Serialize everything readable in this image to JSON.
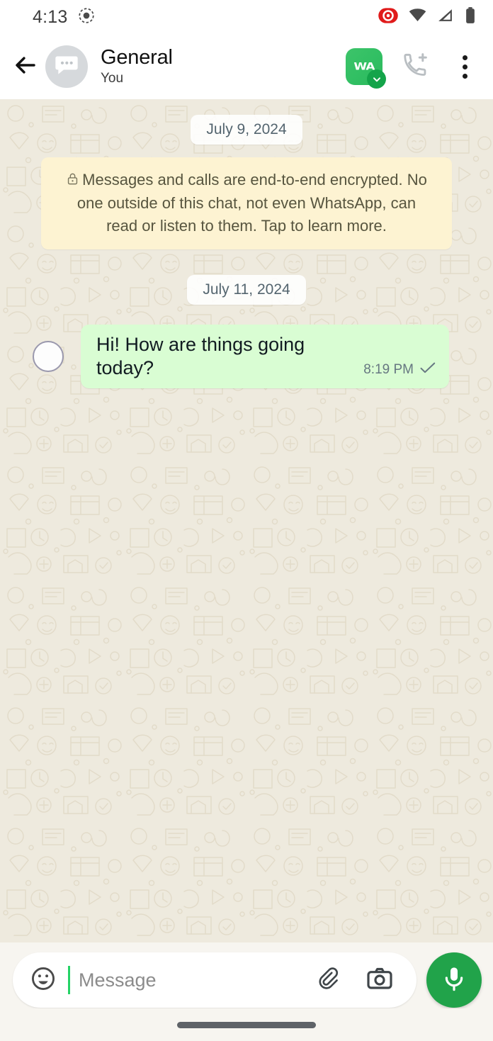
{
  "status_bar": {
    "time": "4:13",
    "left_icons": [
      {
        "name": "screen-record-indicator-icon"
      }
    ],
    "right_icons": [
      {
        "name": "recording-active-icon",
        "color": "#e01b1b"
      },
      {
        "name": "wifi-icon",
        "color": "#4a4a4a"
      },
      {
        "name": "cellular-signal-icon",
        "color": "#4a4a4a"
      },
      {
        "name": "battery-full-icon",
        "color": "#4a4a4a"
      }
    ]
  },
  "app_bar": {
    "back_label": "Back",
    "avatar_icon": "group-chat-bubble-icon",
    "title": "General",
    "subtitle": "You",
    "app_shortcut": {
      "label": "WA",
      "badge_icon": "download-chevron-icon",
      "color": "#31bf63"
    },
    "add_call_label": "Add call",
    "menu_label": "More options"
  },
  "chat": {
    "date_separator_1": "July 9, 2024",
    "encryption_notice": "Messages and calls are end-to-end encrypted. No one outside of this chat, not even WhatsApp, can read or listen to them. Tap to learn more.",
    "date_separator_2": "July 11, 2024",
    "messages": [
      {
        "text": "Hi! How are things going today?",
        "time": "8:19 PM",
        "status_icon": "single-check-icon",
        "outgoing": true,
        "selected": false
      }
    ]
  },
  "composer": {
    "emoji_label": "Emoji",
    "placeholder": "Message",
    "attach_label": "Attach",
    "camera_label": "Camera",
    "mic_label": "Voice message"
  },
  "colors": {
    "bubble_out": "#d9fdd3",
    "chat_bg": "#eeeade",
    "accent_green": "#21a34a",
    "notice_bg": "#fdf3d2"
  }
}
